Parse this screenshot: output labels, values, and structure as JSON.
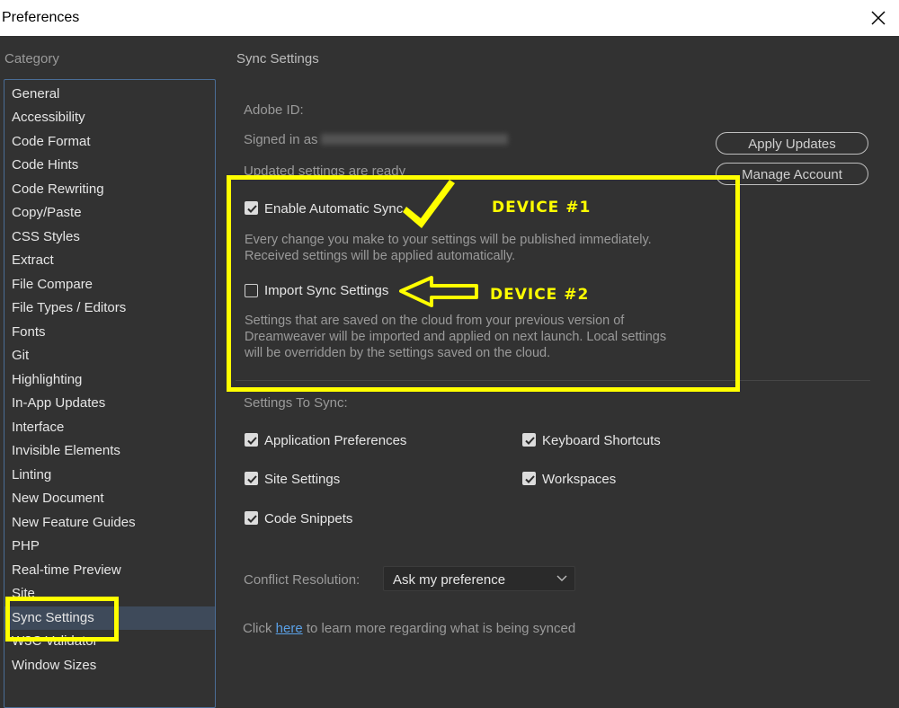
{
  "window": {
    "title": "Preferences",
    "close_icon": "close-icon"
  },
  "category": {
    "label": "Category",
    "items": [
      "General",
      "Accessibility",
      "Code Format",
      "Code Hints",
      "Code Rewriting",
      "Copy/Paste",
      "CSS Styles",
      "Extract",
      "File Compare",
      "File Types / Editors",
      "Fonts",
      "Git",
      "Highlighting",
      "In-App Updates",
      "Interface",
      "Invisible Elements",
      "Linting",
      "New Document",
      "New Feature Guides",
      "PHP",
      "Real-time Preview",
      "Site",
      "Sync Settings",
      "W3C Validator",
      "Window Sizes"
    ],
    "selected": "Sync Settings"
  },
  "sync": {
    "title": "Sync Settings",
    "adobe_id_label": "Adobe ID:",
    "signed_in_label": "Signed in as",
    "updated_ready": "Updated settings are ready",
    "apply_updates": "Apply Updates",
    "manage_account": "Manage Account",
    "enable_auto_sync": {
      "label": "Enable Automatic Sync",
      "checked": true,
      "desc1": "Every change you make to your settings will be published immediately.",
      "desc2": "Received settings will be applied automatically."
    },
    "import_sync": {
      "label": "Import Sync Settings",
      "checked": false,
      "desc1": "Settings that are saved on the cloud from your previous version of",
      "desc2": "Dreamweaver will be imported and applied on next launch. Local settings",
      "desc3": "will be overridden by the settings saved on the cloud."
    },
    "settings_to_sync_label": "Settings To Sync:",
    "options": {
      "app_prefs": {
        "label": "Application Preferences",
        "checked": true
      },
      "keyboard": {
        "label": "Keyboard Shortcuts",
        "checked": true
      },
      "site": {
        "label": "Site Settings",
        "checked": true
      },
      "workspaces": {
        "label": "Workspaces",
        "checked": true
      },
      "snippets": {
        "label": "Code Snippets",
        "checked": true
      }
    },
    "conflict_label": "Conflict Resolution:",
    "conflict_value": "Ask my preference",
    "learn_prefix": "Click ",
    "learn_link": "here",
    "learn_suffix": " to learn more regarding what is being synced"
  },
  "annotations": {
    "device1": "DEVICE #1",
    "device2": "DEVICE #2",
    "color": "#ffff00"
  }
}
